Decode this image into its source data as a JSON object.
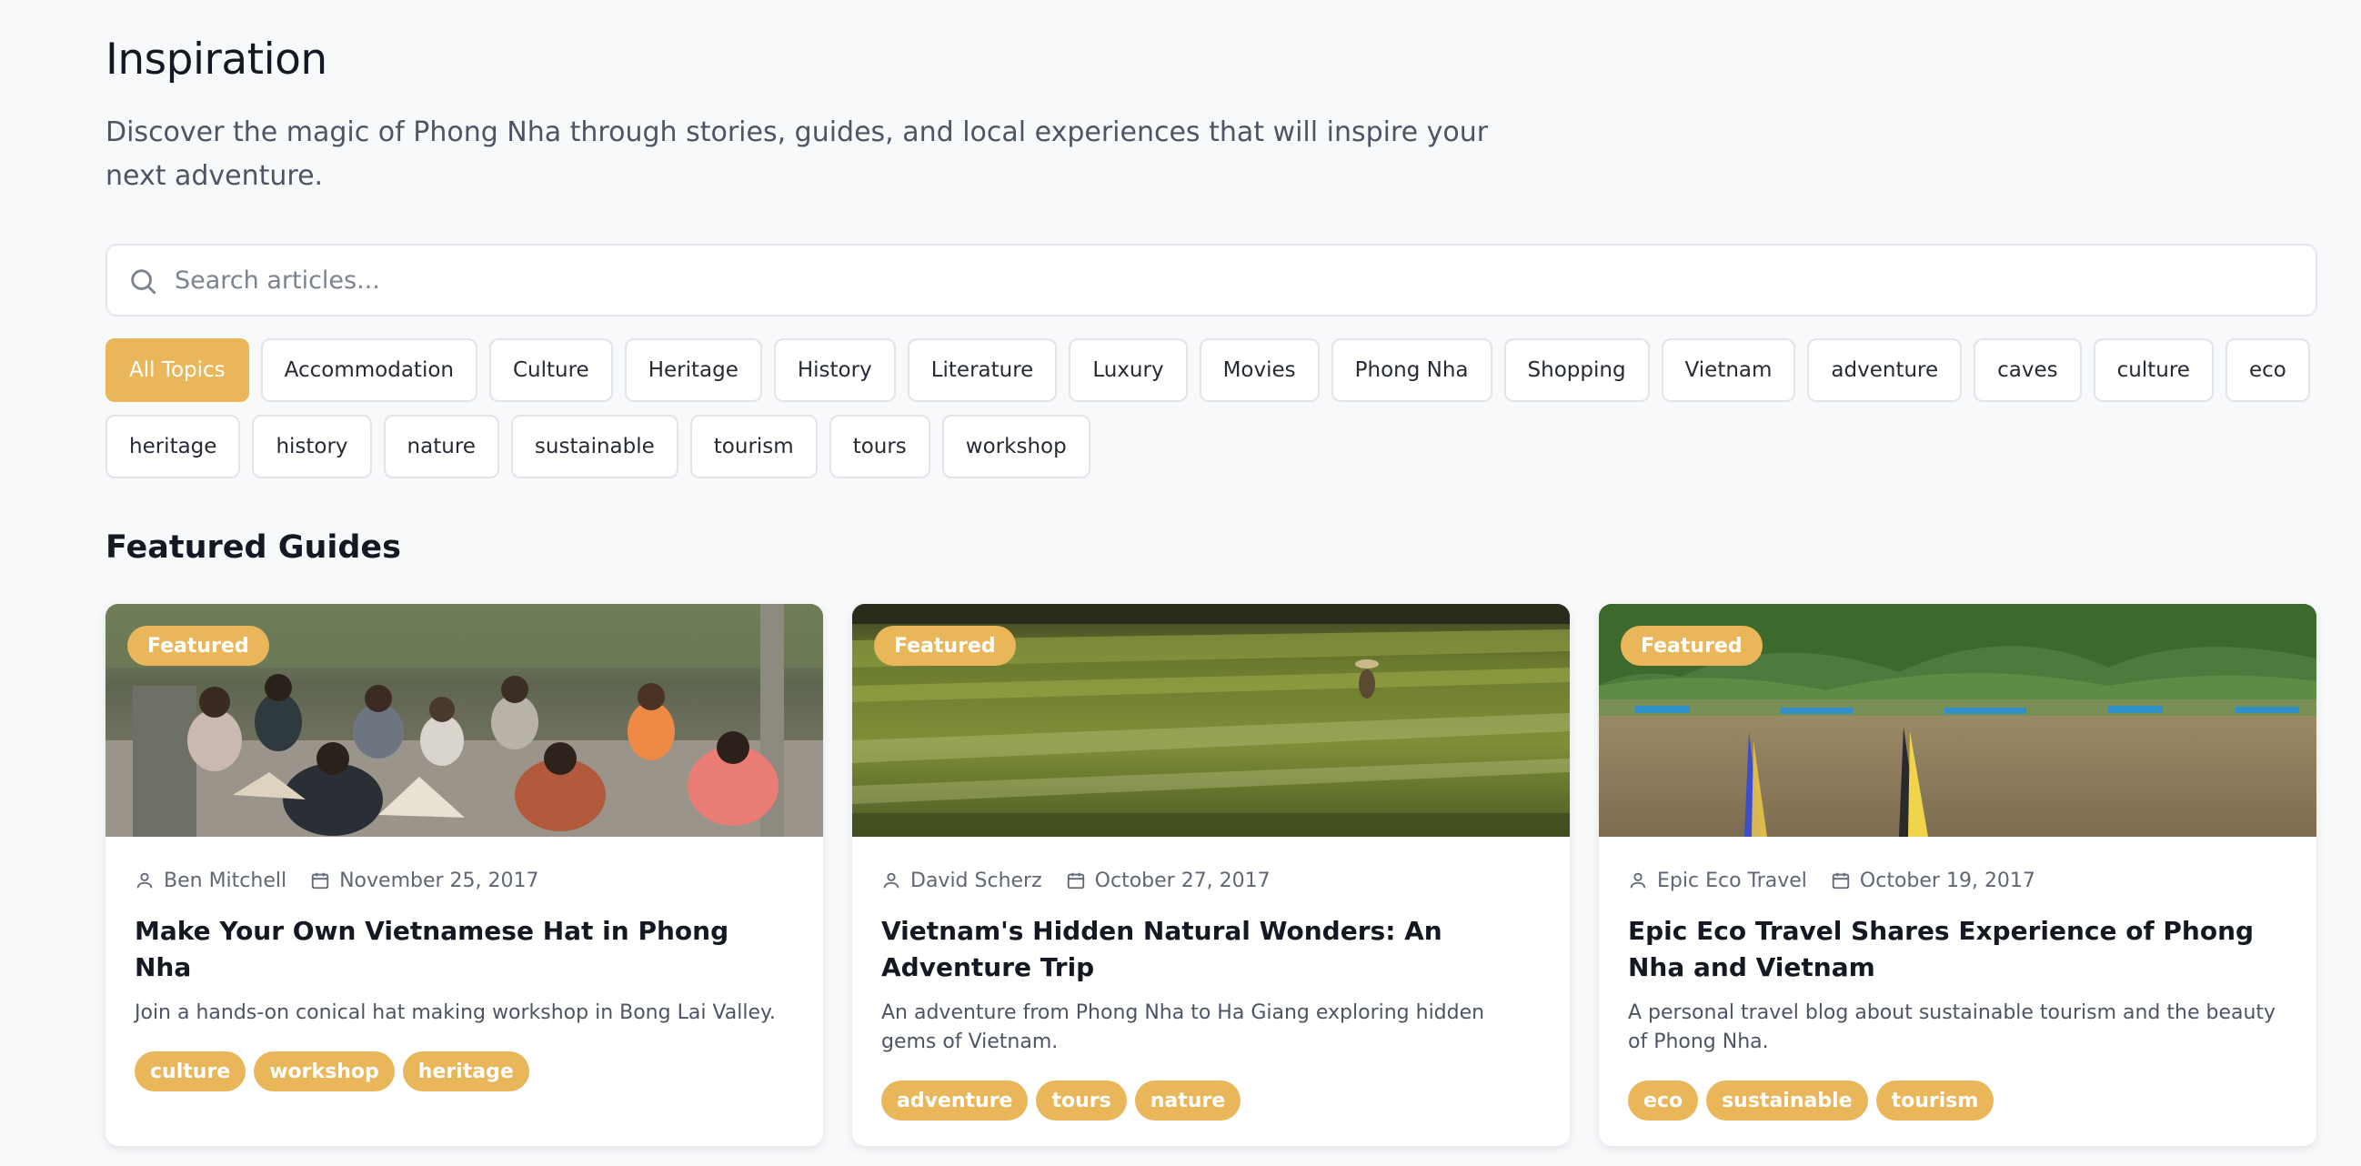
{
  "header": {
    "title": "Inspiration",
    "subtitle": "Discover the magic of Phong Nha through stories, guides, and local experiences that will inspire your next adventure."
  },
  "search": {
    "placeholder": "Search articles...",
    "icon": "search-icon"
  },
  "topics": {
    "active": "All Topics",
    "items": [
      "All Topics",
      "Accommodation",
      "Culture",
      "Heritage",
      "History",
      "Literature",
      "Luxury",
      "Movies",
      "Phong Nha",
      "Shopping",
      "Vietnam",
      "adventure",
      "caves",
      "culture",
      "eco",
      "heritage",
      "history",
      "nature",
      "sustainable",
      "tourism",
      "tours",
      "workshop"
    ]
  },
  "featured": {
    "section_title": "Featured Guides",
    "badge_label": "Featured",
    "cards": [
      {
        "author": "Ben Mitchell",
        "date": "November 25, 2017",
        "title": "Make Your Own Vietnamese Hat in Phong Nha",
        "description": "Join a hands-on conical hat making workshop in Bong Lai Valley.",
        "tags": [
          "culture",
          "workshop",
          "heritage"
        ]
      },
      {
        "author": "David Scherz",
        "date": "October 27, 2017",
        "title": "Vietnam's Hidden Natural Wonders: An Adventure Trip",
        "description": "An adventure from Phong Nha to Ha Giang exploring hidden gems of Vietnam.",
        "tags": [
          "adventure",
          "tours",
          "nature"
        ]
      },
      {
        "author": "Epic Eco Travel",
        "date": "October 19, 2017",
        "title": "Epic Eco Travel Shares Experience of Phong Nha and Vietnam",
        "description": "A personal travel blog about sustainable tourism and the beauty of Phong Nha.",
        "tags": [
          "eco",
          "sustainable",
          "tourism"
        ]
      }
    ]
  },
  "colors": {
    "accent": "#e9b75a",
    "background": "#f8f9fb",
    "text": "#141822",
    "muted": "#4d5564"
  }
}
